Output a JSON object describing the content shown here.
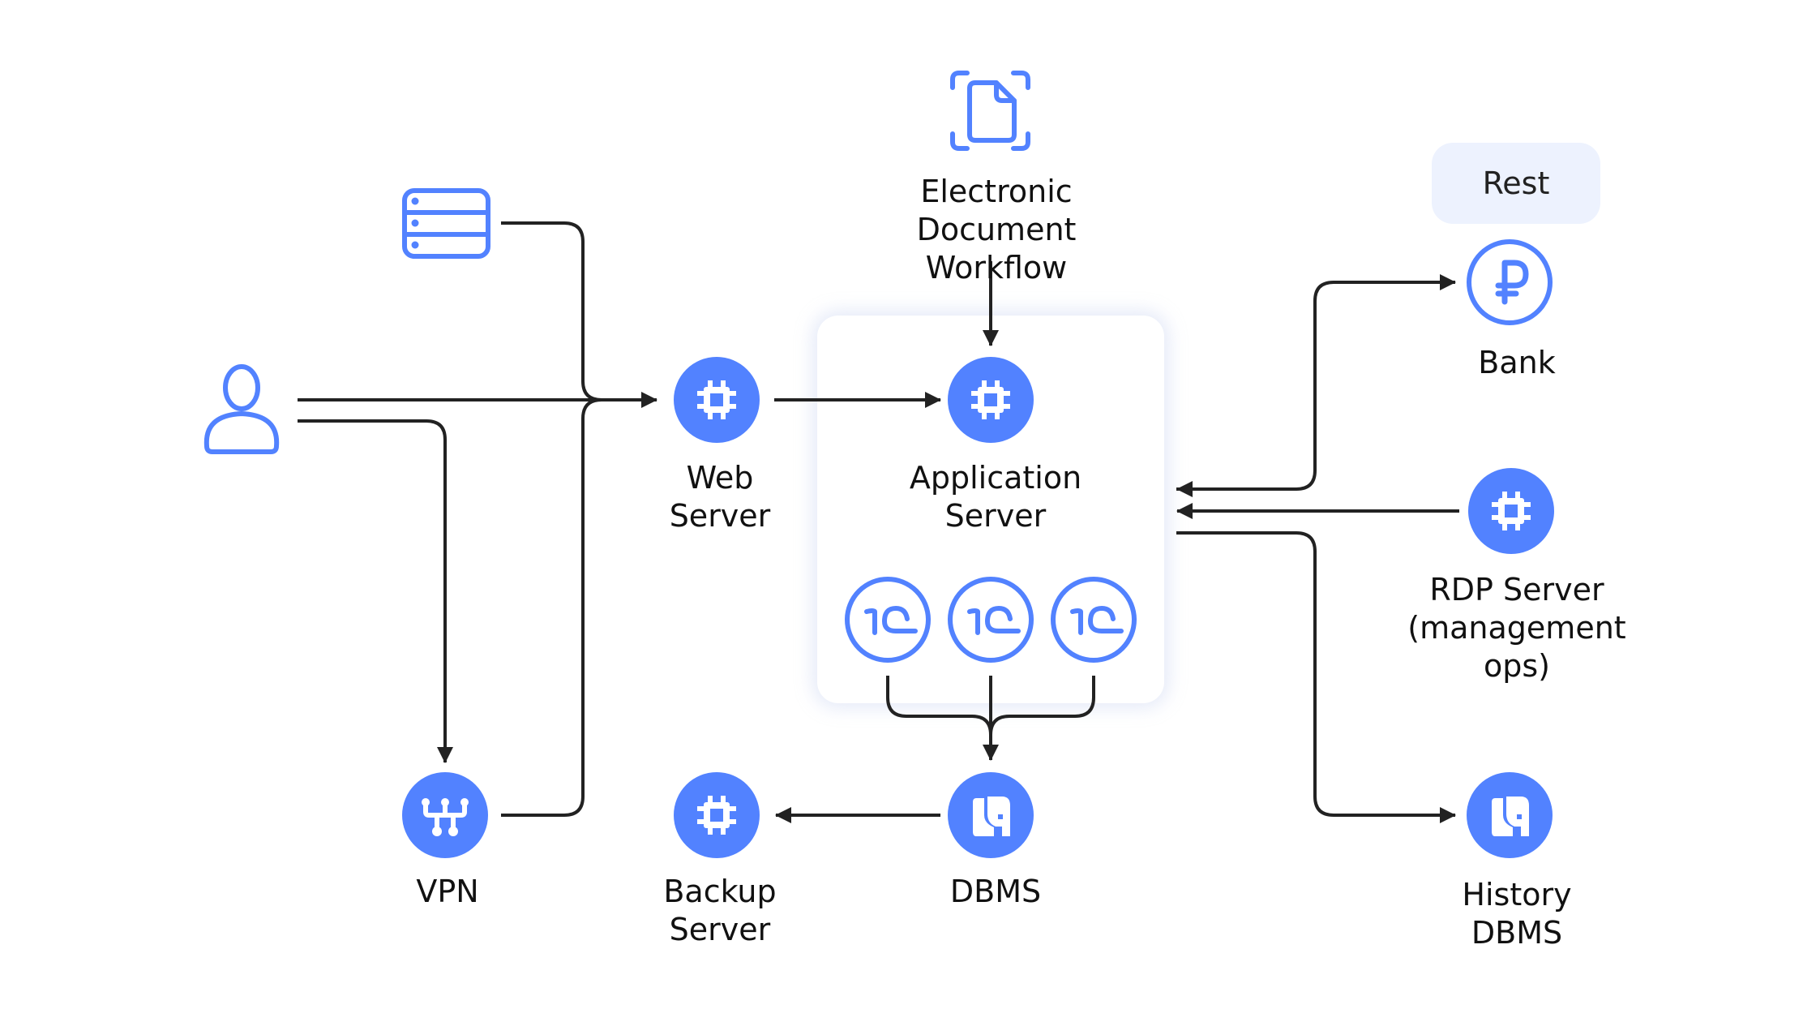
{
  "colors": {
    "accent": "#5282FF",
    "line": "#222222",
    "rest_bg": "#EDF2FE",
    "container_shadow": "#B4C4EB"
  },
  "nodes": {
    "user": {
      "icon": "user-icon"
    },
    "storage": {
      "icon": "storage-server-icon"
    },
    "vpn": {
      "icon": "vpn-network-icon",
      "label": [
        "VPN"
      ]
    },
    "web_server": {
      "icon": "chip-icon",
      "label": [
        "Web",
        "Server"
      ]
    },
    "edw": {
      "icon": "document-scan-icon",
      "label": [
        "Electronic",
        "Document",
        "Workflow"
      ]
    },
    "app_server": {
      "icon": "chip-icon",
      "label": [
        "Application",
        "Server"
      ]
    },
    "onec": [
      {
        "icon": "1c-logo-icon"
      },
      {
        "icon": "1c-logo-icon"
      },
      {
        "icon": "1c-logo-icon"
      }
    ],
    "dbms": {
      "icon": "elephant-db-icon",
      "label": [
        "DBMS"
      ]
    },
    "backup_server": {
      "icon": "chip-icon",
      "label": [
        "Backup",
        "Server"
      ]
    },
    "bank": {
      "icon": "ruble-icon",
      "label": [
        "Bank"
      ]
    },
    "rdp_server": {
      "icon": "chip-icon",
      "label": [
        "RDP Server",
        "(management",
        "ops)"
      ]
    },
    "history_dbms": {
      "icon": "elephant-db-icon",
      "label": [
        "History",
        "DBMS"
      ]
    }
  },
  "rest_label": "Rest",
  "edges": [
    {
      "from": "user",
      "to": "web_server"
    },
    {
      "from": "storage",
      "to": "web_server"
    },
    {
      "from": "user",
      "to": "vpn"
    },
    {
      "from": "vpn",
      "to": "web_server"
    },
    {
      "from": "web_server",
      "to": "app_server"
    },
    {
      "from": "edw",
      "to": "app_server"
    },
    {
      "from": "onec",
      "to": "dbms"
    },
    {
      "from": "dbms",
      "to": "backup_server"
    },
    {
      "from": "app_server",
      "to": "bank"
    },
    {
      "from": "bank",
      "to": "app_server"
    },
    {
      "from": "rdp_server",
      "to": "app_server"
    },
    {
      "from": "app_server",
      "to": "history_dbms"
    }
  ]
}
